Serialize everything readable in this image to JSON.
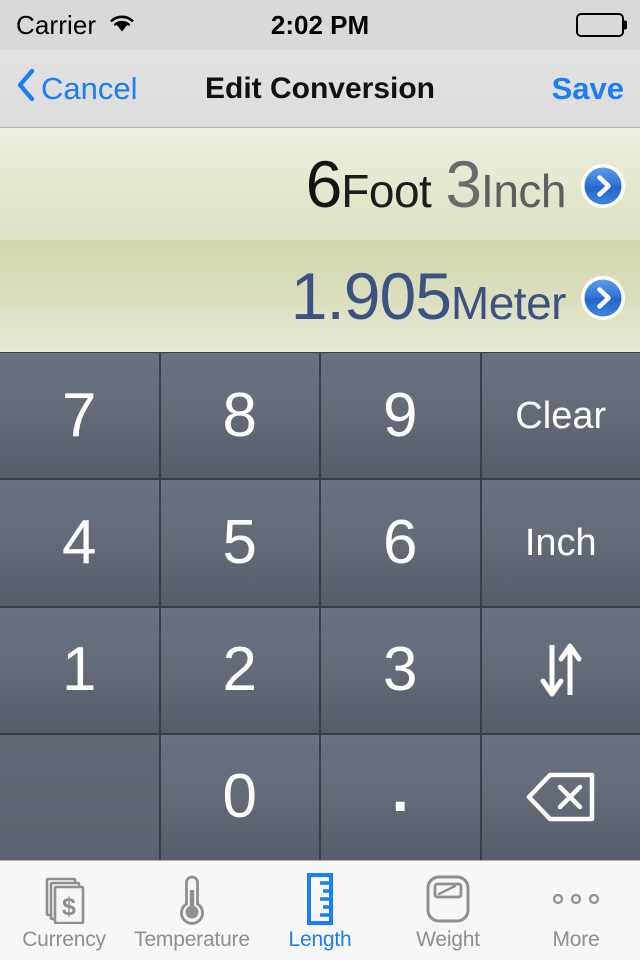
{
  "status_bar": {
    "carrier": "Carrier",
    "wifi_icon": "wifi-icon",
    "time": "2:02 PM",
    "battery_icon": "battery-full-icon"
  },
  "nav_bar": {
    "back_icon": "chevron-left-icon",
    "cancel_label": "Cancel",
    "title": "Edit Conversion",
    "save_label": "Save",
    "accent_color": "#1a7ef5"
  },
  "display": {
    "primary": {
      "value_a": "6",
      "unit_a": "Foot",
      "value_b": "3",
      "unit_b": "Inch",
      "disclosure_icon": "chevron-right-circle-icon"
    },
    "secondary": {
      "value": "1.905",
      "unit": "Meter",
      "disclosure_icon": "chevron-right-circle-icon",
      "text_color": "#3c5282"
    }
  },
  "keypad": {
    "keys": [
      {
        "name": "key-7",
        "label": "7",
        "kind": "digit"
      },
      {
        "name": "key-8",
        "label": "8",
        "kind": "digit"
      },
      {
        "name": "key-9",
        "label": "9",
        "kind": "digit"
      },
      {
        "name": "key-clear",
        "label": "Clear",
        "kind": "word"
      },
      {
        "name": "key-4",
        "label": "4",
        "kind": "digit"
      },
      {
        "name": "key-5",
        "label": "5",
        "kind": "digit"
      },
      {
        "name": "key-6",
        "label": "6",
        "kind": "digit"
      },
      {
        "name": "key-inch",
        "label": "Inch",
        "kind": "word"
      },
      {
        "name": "key-1",
        "label": "1",
        "kind": "digit"
      },
      {
        "name": "key-2",
        "label": "2",
        "kind": "digit"
      },
      {
        "name": "key-3",
        "label": "3",
        "kind": "digit"
      },
      {
        "name": "key-swap",
        "label": "",
        "kind": "icon",
        "icon": "swap-arrows-icon"
      },
      {
        "name": "key-blank",
        "label": "",
        "kind": "blank"
      },
      {
        "name": "key-0",
        "label": "0",
        "kind": "digit"
      },
      {
        "name": "key-decimal",
        "label": ".",
        "kind": "dot"
      },
      {
        "name": "key-backspace",
        "label": "",
        "kind": "icon",
        "icon": "backspace-delete-icon"
      }
    ]
  },
  "tab_bar": {
    "active_index": 2,
    "accent_color": "#1a7ef5",
    "inactive_color": "#8e8e93",
    "tabs": [
      {
        "name": "tab-currency",
        "label": "Currency",
        "icon": "money-bills-icon"
      },
      {
        "name": "tab-temperature",
        "label": "Temperature",
        "icon": "thermometer-icon"
      },
      {
        "name": "tab-length",
        "label": "Length",
        "icon": "ruler-icon"
      },
      {
        "name": "tab-weight",
        "label": "Weight",
        "icon": "scale-icon"
      },
      {
        "name": "tab-more",
        "label": "More",
        "icon": "ellipsis-icon"
      }
    ]
  }
}
